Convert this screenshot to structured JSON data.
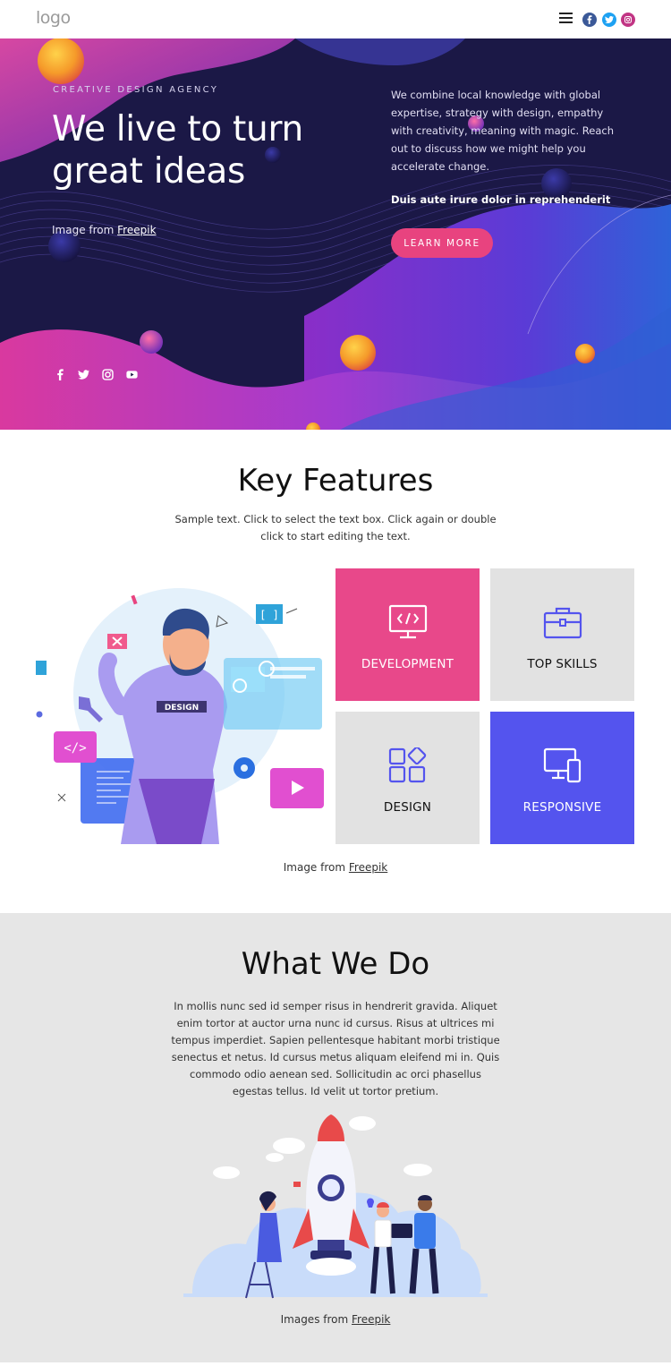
{
  "header": {
    "logo": "logo",
    "social": [
      {
        "name": "facebook-icon",
        "color": "#3b5998"
      },
      {
        "name": "twitter-icon",
        "color": "#1da1f2"
      },
      {
        "name": "instagram-icon",
        "color": "#c13584"
      }
    ]
  },
  "hero": {
    "eyebrow": "CREATIVE DESIGN AGENCY",
    "title": "We live to turn great ideas",
    "credit_prefix": "Image from",
    "credit_link": "Freepik",
    "description": "We combine local knowledge with global expertise, strategy with design, empathy with creativity, meaning with magic. Reach out to discuss how we might help you accelerate change.",
    "bold_text": "Duis aute irure dolor in reprehenderit",
    "button_label": "LEARN MORE",
    "button_color": "#e8437f",
    "social": [
      "facebook-icon",
      "twitter-icon",
      "instagram-icon",
      "youtube-icon"
    ]
  },
  "features": {
    "title": "Key Features",
    "subtitle": "Sample text. Click to select the text box. Click again or double click to start editing the text.",
    "tiles": [
      {
        "label": "DEVELOPMENT",
        "icon": "monitor-code-icon",
        "bg": "#e8488a",
        "fg": "#ffffff"
      },
      {
        "label": "TOP SKILLS",
        "icon": "briefcase-icon",
        "bg": "#e2e2e2",
        "fg": "#111111"
      },
      {
        "label": "DESIGN",
        "icon": "shapes-icon",
        "bg": "#e2e2e2",
        "fg": "#111111"
      },
      {
        "label": "RESPONSIVE",
        "icon": "devices-icon",
        "bg": "#5454ee",
        "fg": "#ffffff"
      }
    ],
    "credit_prefix": "Image from",
    "credit_link": "Freepik"
  },
  "whatwedo": {
    "title": "What We Do",
    "text": "In mollis nunc sed id semper risus in hendrerit gravida. Aliquet enim tortor at auctor urna nunc id cursus. Risus at ultrices mi tempus imperdiet. Sapien pellentesque habitant morbi tristique senectus et netus. Id cursus metus aliquam eleifend mi in. Quis commodo odio aenean sed. Sollicitudin ac orci phasellus egestas tellus. Id velit ut tortor pretium.",
    "credit_prefix": "Images from",
    "credit_link": "Freepik"
  }
}
